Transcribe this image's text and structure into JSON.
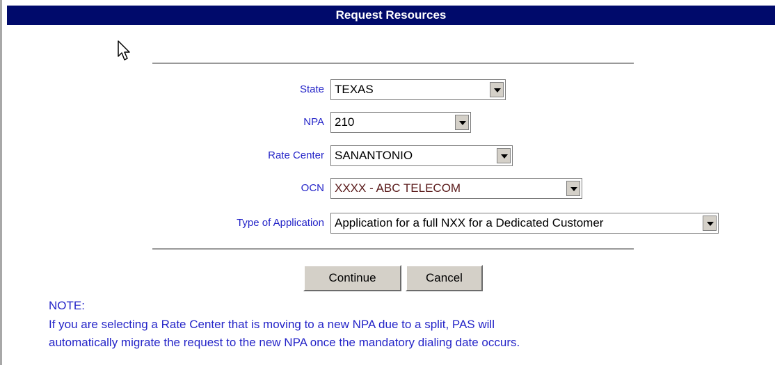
{
  "window": {
    "title": "Request Resources"
  },
  "form": {
    "state": {
      "label": "State",
      "value": "TEXAS"
    },
    "npa": {
      "label": "NPA",
      "value": "210"
    },
    "rate_center": {
      "label": "Rate Center",
      "value": "SANANTONIO"
    },
    "ocn": {
      "label": "OCN",
      "value": "XXXX - ABC TELECOM",
      "value_color": "#5a1a1a"
    },
    "application_type": {
      "label": "Type of Application",
      "value": "Application for a full NXX for a Dedicated Customer"
    }
  },
  "buttons": {
    "continue_label": "Continue",
    "cancel_label": "Cancel"
  },
  "note": {
    "heading": "NOTE:",
    "line1": "If you are selecting a Rate Center that is moving to a new NPA due to a split, PAS will",
    "line2": "automatically migrate the request to the new NPA once the mandatory dialing date occurs."
  },
  "colors": {
    "title_bar": "#000a6b",
    "label_text": "#2424c8",
    "button_face": "#d4d0c8"
  },
  "icons": {
    "cursor": "mouse-pointer-icon",
    "dropdown": "chevron-down-icon"
  }
}
